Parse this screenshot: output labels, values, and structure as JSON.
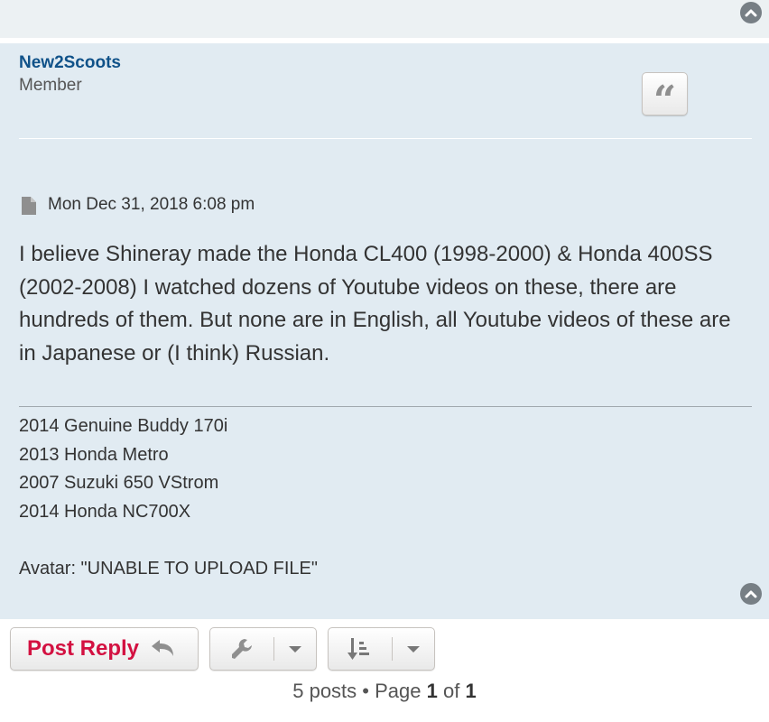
{
  "post": {
    "author": "New2Scoots",
    "rank": "Member",
    "date": "Mon Dec 31, 2018 6:08 pm",
    "content": "I believe Shineray made the Honda CL400 (1998-2000) & Honda 400SS (2002-2008) I watched dozens of Youtube videos on these, there are hundreds of them. But none are in English, all Youtube videos of these are in Japanese or (I think) Russian.",
    "signature": [
      "2014 Genuine Buddy 170i",
      "2013 Honda Metro",
      "2007 Suzuki 650 VStrom",
      "2014 Honda NC700X",
      "",
      "Avatar: \"UNABLE TO UPLOAD FILE\""
    ],
    "quote_glyph": "“"
  },
  "actions": {
    "post_reply_label": "Post Reply"
  },
  "pagination": {
    "posts_text": "5 posts",
    "separator": "•",
    "page_word": "Page",
    "current_page": "1",
    "of_word": "of",
    "total_pages": "1"
  },
  "colors": {
    "post_bg": "#e1ebf2",
    "author": "#105289",
    "reply": "#d31141"
  },
  "icons": [
    "chevron-up-icon",
    "quote-icon",
    "post-file-icon",
    "reply-arrow-icon",
    "wrench-icon",
    "caret-down-icon",
    "sort-icon"
  ]
}
